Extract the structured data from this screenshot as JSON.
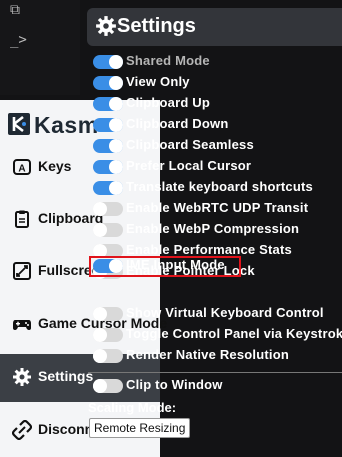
{
  "terminal": {
    "icon1": "⧉",
    "icon2": "_>"
  },
  "kasm": {
    "brand": "Kasm",
    "sidebar": [
      {
        "label": "Keys",
        "icon": "keyboard-icon"
      },
      {
        "label": "Clipboard",
        "icon": "clipboard-icon"
      },
      {
        "label": "Fullscreen",
        "icon": "expand-icon"
      },
      {
        "label": "Game Cursor Mode",
        "icon": "gamepad-icon"
      },
      {
        "label": "Settings",
        "icon": "gear-icon"
      },
      {
        "label": "Disconnect",
        "icon": "disconnect-icon"
      }
    ]
  },
  "settings": {
    "title": "Settings",
    "options": [
      {
        "label": "Shared Mode",
        "on": true,
        "disabled": true
      },
      {
        "label": "View Only",
        "on": true
      },
      {
        "label": "Clipboard Up",
        "on": true
      },
      {
        "label": "Clipboard Down",
        "on": true
      },
      {
        "label": "Clipboard Seamless",
        "on": true
      },
      {
        "label": "Prefer Local Cursor",
        "on": true
      },
      {
        "label": "Translate keyboard shortcuts",
        "on": true
      },
      {
        "label": "Enable WebRTC UDP Transit",
        "on": false
      },
      {
        "label": "Enable WebP Compression",
        "on": false
      },
      {
        "label": "Enable Performance Stats",
        "on": false
      },
      {
        "label": "Enable Pointer Lock",
        "on": false
      },
      {
        "label": "IME Input Mode",
        "on": true
      },
      {
        "label": "Show Virtual Keyboard Control",
        "on": false
      },
      {
        "label": "Toggle Control Panel via Keystrokes",
        "on": false
      },
      {
        "label": "Render Native Resolution",
        "on": false
      }
    ],
    "clip_to_window": {
      "label": "Clip to Window",
      "on": false
    },
    "scaling_mode_label": "Scaling Mode:",
    "scaling_mode_value": "Remote Resizing"
  },
  "colors": {
    "toggle_on": "#3a8ee6",
    "toggle_off": "#d9d9d9",
    "highlight": "#e0131b",
    "header_bg": "#33353a"
  }
}
